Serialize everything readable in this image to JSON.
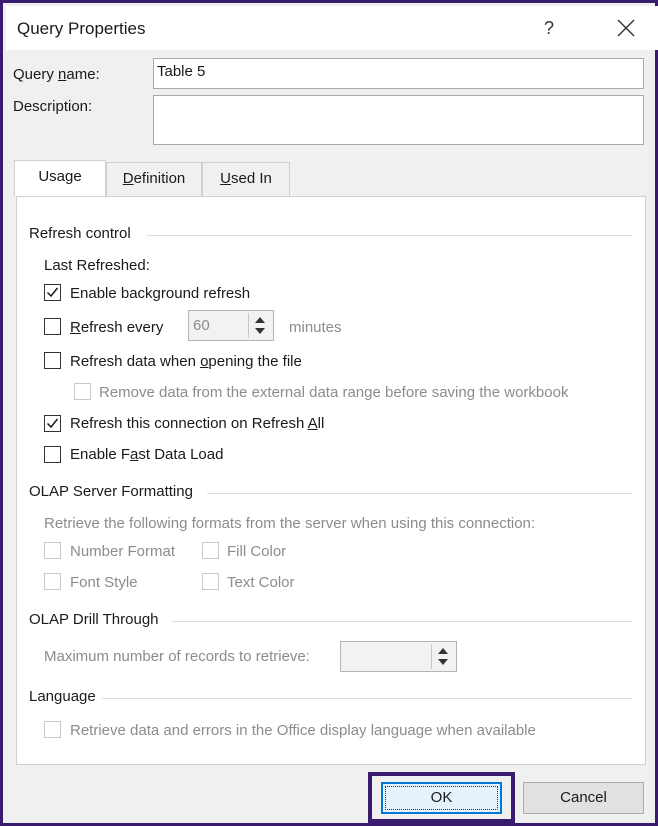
{
  "window": {
    "title": "Query Properties",
    "help_glyph": "?"
  },
  "fields": {
    "query_name_label_pre": "Query ",
    "query_name_label_ul": "n",
    "query_name_label_post": "ame:",
    "query_name_value": "Table 5",
    "description_label": "Description:",
    "description_value": ""
  },
  "tabs": [
    {
      "label": "Usage",
      "active": true
    },
    {
      "label_ul": "D",
      "label_rest": "efinition",
      "active": false
    },
    {
      "label_ul": "U",
      "label_rest": "sed In",
      "active": false
    }
  ],
  "refresh_control": {
    "title": "Refresh control",
    "last_refreshed": "Last Refreshed:",
    "enable_background": {
      "label": "Enable background refresh",
      "checked": true
    },
    "refresh_every": {
      "label_ul": "R",
      "label_rest": "efresh every",
      "checked": false,
      "value": "60",
      "unit": "minutes"
    },
    "refresh_on_open": {
      "label_pre": "Refresh data when ",
      "label_ul": "o",
      "label_post": "pening the file",
      "checked": false
    },
    "remove_data": {
      "label": "Remove data from the external data range before saving the workbook",
      "checked": false,
      "disabled": true
    },
    "refresh_all": {
      "label_pre": "Refresh this connection on Refresh ",
      "label_ul": "A",
      "label_post": "ll",
      "checked": true
    },
    "fast_load": {
      "label_pre": "Enable F",
      "label_ul": "a",
      "label_post": "st Data Load",
      "checked": false
    }
  },
  "olap_formatting": {
    "title": "OLAP Server Formatting",
    "description": "Retrieve the following formats from the server when using this connection:",
    "number_format": "Number Format",
    "fill_color": "Fill Color",
    "font_style": "Font Style",
    "text_color": "Text Color"
  },
  "olap_drill": {
    "title": "OLAP Drill Through",
    "max_records_label": "Maximum number of records to retrieve:",
    "max_records_value": ""
  },
  "language": {
    "title": "Language",
    "office_language": "Retrieve data and errors in the Office display language when available"
  },
  "buttons": {
    "ok": "OK",
    "cancel": "Cancel"
  },
  "colors": {
    "frame": "#3a1c6e",
    "ok_focus": "#0078d7"
  },
  "icons": [
    "help-icon",
    "close-icon",
    "checkmark-icon",
    "spin-up-icon",
    "spin-down-icon"
  ]
}
